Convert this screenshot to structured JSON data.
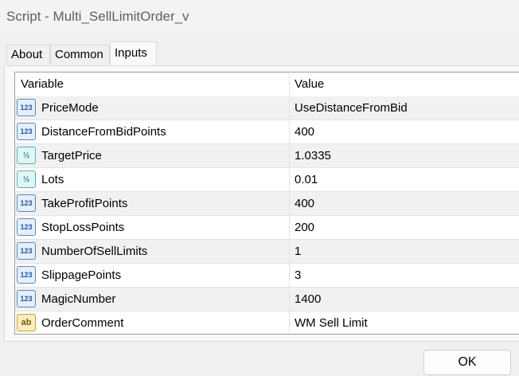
{
  "window": {
    "title": "Script - Multi_SellLimitOrder_v"
  },
  "tabs": [
    {
      "label": "About"
    },
    {
      "label": "Common"
    },
    {
      "label": "Inputs",
      "active": true
    }
  ],
  "table": {
    "headers": {
      "variable": "Variable",
      "value": "Value"
    },
    "rows": [
      {
        "icon": "int-type-icon",
        "icon_text": "123",
        "name": "PriceMode",
        "value": "UseDistanceFromBid"
      },
      {
        "icon": "int-type-icon",
        "icon_text": "123",
        "name": "DistanceFromBidPoints",
        "value": "400"
      },
      {
        "icon": "double-type-icon",
        "icon_text": "½",
        "name": "TargetPrice",
        "value": "1.0335"
      },
      {
        "icon": "double-type-icon",
        "icon_text": "½",
        "name": "Lots",
        "value": "0.01"
      },
      {
        "icon": "int-type-icon",
        "icon_text": "123",
        "name": "TakeProfitPoints",
        "value": "400"
      },
      {
        "icon": "int-type-icon",
        "icon_text": "123",
        "name": "StopLossPoints",
        "value": "200"
      },
      {
        "icon": "int-type-icon",
        "icon_text": "123",
        "name": "NumberOfSellLimits",
        "value": "1"
      },
      {
        "icon": "int-type-icon",
        "icon_text": "123",
        "name": "SlippagePoints",
        "value": "3"
      },
      {
        "icon": "int-type-icon",
        "icon_text": "123",
        "name": "MagicNumber",
        "value": "1400"
      },
      {
        "icon": "string-type-icon",
        "icon_text": "ab",
        "name": "OrderComment",
        "value": "WM Sell Limit"
      }
    ]
  },
  "buttons": {
    "ok": "OK"
  }
}
